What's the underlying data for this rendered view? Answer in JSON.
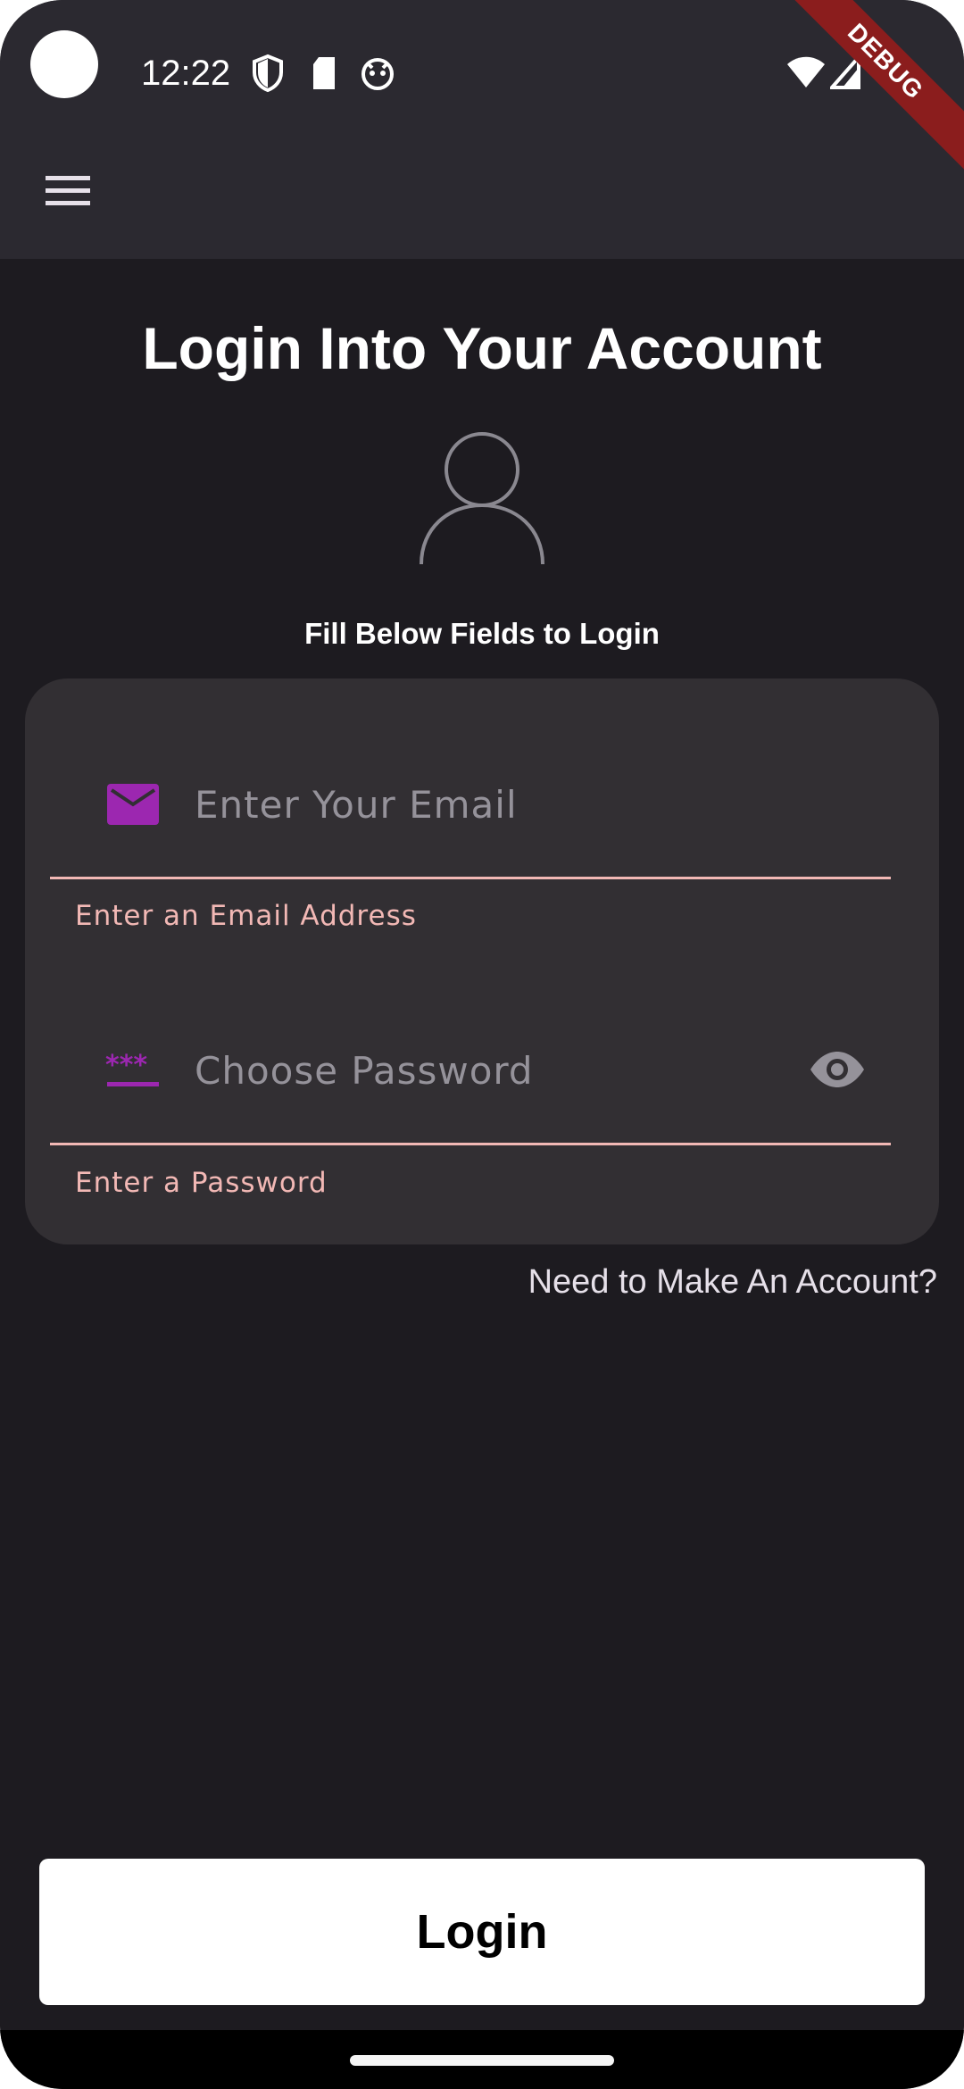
{
  "status_bar": {
    "time": "12:22",
    "icons": [
      "shield-icon",
      "sd-card-icon",
      "cat-face-icon",
      "wifi-icon",
      "signal-icon"
    ],
    "debug_banner": "DEBUG"
  },
  "app_bar": {
    "menu_icon": "hamburger-menu-icon"
  },
  "header": {
    "title": "Login Into Your Account",
    "avatar_icon": "person-outline-icon",
    "subtitle": "Fill Below Fields to Login"
  },
  "form": {
    "email": {
      "icon": "mail-icon",
      "placeholder": "Enter Your Email",
      "value": "",
      "error": "Enter an Email Address"
    },
    "password": {
      "icon": "password-dots-icon",
      "placeholder": "Choose Password",
      "value": "",
      "error": "Enter a Password",
      "toggle_icon": "eye-icon"
    }
  },
  "signup_link": "Need to Make An Account?",
  "login_button": "Login",
  "colors": {
    "background": "#1d1b20",
    "app_bar": "#2b2930",
    "card": "#322f33",
    "accent_icon": "#9c27b0",
    "error": "#f2b8b5",
    "debug_ribbon": "#8b1d1d"
  }
}
